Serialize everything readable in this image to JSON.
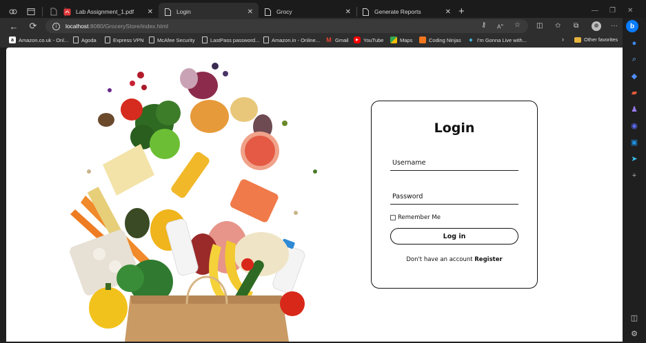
{
  "tabs": [
    {
      "title": "Lab Assignment_1.pdf",
      "icon": "pdf-icon"
    },
    {
      "title": "Login",
      "icon": "document-icon",
      "active": true
    },
    {
      "title": "Grocy",
      "icon": "document-icon"
    },
    {
      "title": "Generate Reports",
      "icon": "document-icon"
    }
  ],
  "address": {
    "host": "localhost",
    "path": ":8080/GroceryStore/index.html"
  },
  "favorites": [
    {
      "label": "Amazon.co.uk - Onl...",
      "icon": "amazon-icon"
    },
    {
      "label": "Agoda",
      "icon": "document-icon"
    },
    {
      "label": "Express VPN",
      "icon": "document-icon"
    },
    {
      "label": "McAfee Security",
      "icon": "document-icon"
    },
    {
      "label": "LastPass password...",
      "icon": "document-icon"
    },
    {
      "label": "Amazon.in - Online...",
      "icon": "document-icon"
    },
    {
      "label": "Gmail",
      "icon": "gmail-icon"
    },
    {
      "label": "YouTube",
      "icon": "youtube-icon"
    },
    {
      "label": "Maps",
      "icon": "maps-icon"
    },
    {
      "label": "Coding Ninjas",
      "icon": "coding-ninjas-icon"
    },
    {
      "label": "I'm Gonna Live with...",
      "icon": "globe-icon"
    },
    {
      "label": "Other favorites",
      "icon": "folder-icon"
    }
  ],
  "login": {
    "title": "Login",
    "username_placeholder": "Username",
    "password_placeholder": "Password",
    "remember_label": "Remember Me",
    "button_label": "Log in",
    "register_prompt": "Don't have an account",
    "register_link": "Register"
  },
  "colors": {
    "browser_bg": "#1f1f1f",
    "toolbar_bg": "#2e2e2e",
    "page_bg": "#ffffff",
    "card_border": "#111111",
    "edge_accent": "#0a7cff"
  }
}
